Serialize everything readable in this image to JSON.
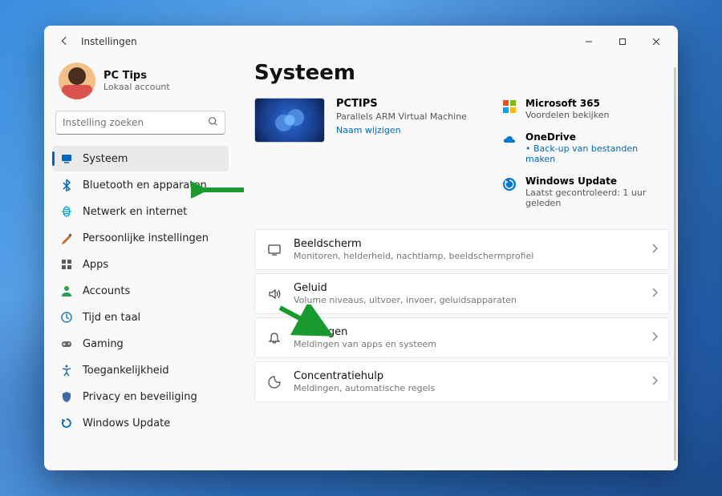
{
  "window": {
    "title": "Instellingen"
  },
  "profile": {
    "name": "PC Tips",
    "sub": "Lokaal account"
  },
  "search": {
    "placeholder": "Instelling zoeken"
  },
  "sidebar": [
    {
      "id": "systeem",
      "label": "Systeem",
      "selected": true,
      "color": "#0067c0"
    },
    {
      "id": "bluetooth",
      "label": "Bluetooth en apparaten",
      "color": "#0067c0"
    },
    {
      "id": "netwerk",
      "label": "Netwerk en internet",
      "color": "#00a2d8"
    },
    {
      "id": "personal",
      "label": "Persoonlijke instellingen",
      "color": "#c66b2b"
    },
    {
      "id": "apps",
      "label": "Apps",
      "color": "#5a5a5a"
    },
    {
      "id": "accounts",
      "label": "Accounts",
      "color": "#2a9d5a"
    },
    {
      "id": "tijd",
      "label": "Tijd en taal",
      "color": "#2b7db8"
    },
    {
      "id": "gaming",
      "label": "Gaming",
      "color": "#6a6a6a"
    },
    {
      "id": "toegankelijkheid",
      "label": "Toegankelijkheid",
      "color": "#2a6db0"
    },
    {
      "id": "privacy",
      "label": "Privacy en beveiliging",
      "color": "#3a6aa8"
    },
    {
      "id": "update",
      "label": "Windows Update",
      "color": "#0067c0"
    }
  ],
  "page": {
    "heading": "Systeem",
    "device": {
      "name": "PCTIPS",
      "sub": "Parallels ARM Virtual Machine",
      "rename": "Naam wijzigen"
    },
    "right": {
      "m365": {
        "title": "Microsoft 365",
        "sub": "Voordelen bekijken"
      },
      "onedrive": {
        "title": "OneDrive",
        "bullet": "Back-up van bestanden maken"
      },
      "update": {
        "title": "Windows Update",
        "sub": "Laatst gecontroleerd: 1 uur geleden"
      }
    },
    "items": [
      {
        "id": "beeldscherm",
        "title": "Beeldscherm",
        "sub": "Monitoren, helderheid, nachtlamp, beeldschermprofiel"
      },
      {
        "id": "geluid",
        "title": "Geluid",
        "sub": "Volume niveaus, uitvoer, invoer, geluidsapparaten"
      },
      {
        "id": "meldingen",
        "title": "Meldingen",
        "sub": "Meldingen van apps en systeem"
      },
      {
        "id": "focus",
        "title": "Concentratiehulp",
        "sub": "Meldingen, automatische regels"
      }
    ]
  }
}
